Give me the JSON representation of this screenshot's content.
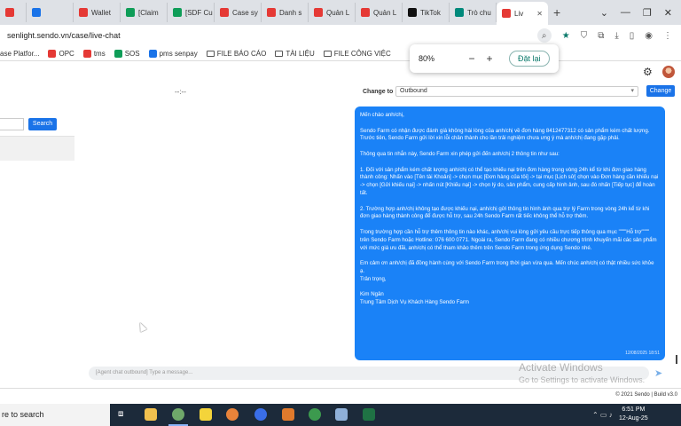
{
  "browser": {
    "tabs": [
      {
        "label": "",
        "color": "#e53935"
      },
      {
        "label": "",
        "color": "#1a73e8"
      },
      {
        "label": "Wallet",
        "color": "#e53935"
      },
      {
        "label": "[Claim",
        "color": "#0f9d58"
      },
      {
        "label": "[SDF Cu",
        "color": "#0f9d58"
      },
      {
        "label": "Case sy",
        "color": "#e53935"
      },
      {
        "label": "Danh s",
        "color": "#e53935"
      },
      {
        "label": "Quản L",
        "color": "#e53935"
      },
      {
        "label": "Quản L",
        "color": "#e53935"
      },
      {
        "label": "TikTok",
        "color": "#111111"
      },
      {
        "label": "Trò chu",
        "color": "#00897b"
      },
      {
        "label": "Liv",
        "color": "#e53935",
        "active": true
      }
    ],
    "url": "senlight.sendo.vn/case/live-chat",
    "bookmarks": [
      {
        "label": "ase Platfor...",
        "type": "page"
      },
      {
        "label": "OPC",
        "type": "sendo"
      },
      {
        "label": "tms",
        "type": "sendo"
      },
      {
        "label": "SOS",
        "type": "sos"
      },
      {
        "label": "pms senpay",
        "type": "pms"
      },
      {
        "label": "FILE BÁO CÁO",
        "type": "folder"
      },
      {
        "label": "TÀI LIỆU",
        "type": "folder"
      },
      {
        "label": "FILE CÔNG VIỆC",
        "type": "folder"
      }
    ]
  },
  "zoom": {
    "percent": "80%",
    "reset_label": "Đặt lại"
  },
  "header": {
    "placeholder_dash": "--:--",
    "change_to_label": "Change to",
    "select_value": "Outbound",
    "change_button": "Change"
  },
  "left": {
    "search_button": "Search"
  },
  "chat": {
    "paragraphs": [
      "Mến chào anh/chị,",
      "Sendo Farm có nhận được đánh giá không hài lòng của anh/chị về đơn hàng 8412477312 có sản phẩm kém chất lượng. Trước tiên, Sendo Farm gửi lời xin lỗi chân thành cho lần trải nghiệm chưa ưng ý mà anh/chị đang gặp phải.",
      "Thông qua tin nhắn này, Sendo Farm xin phép gửi đến anh/chị 2 thông tin như sau:",
      "1. Đối với sản phẩm kém chất lượng anh/chị có thể tạo khiếu nại trên đơn hàng trong vòng 24h kể từ khi đơn giao hàng thành công: Nhấn vào [Tên tài Khoản] -> chọn mục [Đơn hàng của tôi] -> tại mục [Lịch sử] chọn vào Đơn hàng cần khiếu nại -> chọn [Gửi khiếu nại] -> nhấn nút [Khiếu nại] -> chọn lý do, sản phẩm, cung cấp hình ảnh, sau đó nhấn [Tiếp tục] để hoàn tất.",
      "2. Trường hợp anh/chị không tạo được khiếu nại, anh/chị gửi thông tin hình ảnh qua trợ lý Farm trong vòng 24h kể từ khi đơn giao hàng thành công để được hỗ trợ, sau 24h Sendo Farm rất tiếc không thể hỗ trợ thêm.",
      "Trong trường hợp cần hỗ trợ thêm thông tin nào khác, anh/chị vui lòng gửi yêu cầu trực tiếp thông qua mục \"\"\"\"Hỗ trợ\"\"\"\" trên Sendo Farm hoặc Hotline: 076 600 0771. Ngoài ra, Sendo Farm đang có nhiều chương trình khuyến mãi các sản phẩm với mức giá ưu đãi, anh/chị có thể tham khảo thêm trên Sendo Farm trong ứng dụng Sendo nhé.",
      "Em cảm ơn anh/chị đã đồng hành cùng với Sendo Farm trong thời gian vừa qua. Mến chúc anh/chị có thật nhiều sức khỏe ạ.",
      "Trân trọng,",
      "Kim Ngân",
      "Trung Tâm Dịch Vụ Khách Hàng Sendo Farm"
    ],
    "timestamp": "12/08/2025 18:51",
    "input_placeholder": "[Agent chat outbound] Type a message..."
  },
  "watermark": {
    "line1": "Activate Windows",
    "line2": "Go to Settings to activate Windows."
  },
  "footer": {
    "text": "© 2021 Sendo | Build v3.0"
  },
  "taskbar": {
    "search_text": "re to search",
    "time": "6:51 PM",
    "date": "12-Aug-25"
  }
}
